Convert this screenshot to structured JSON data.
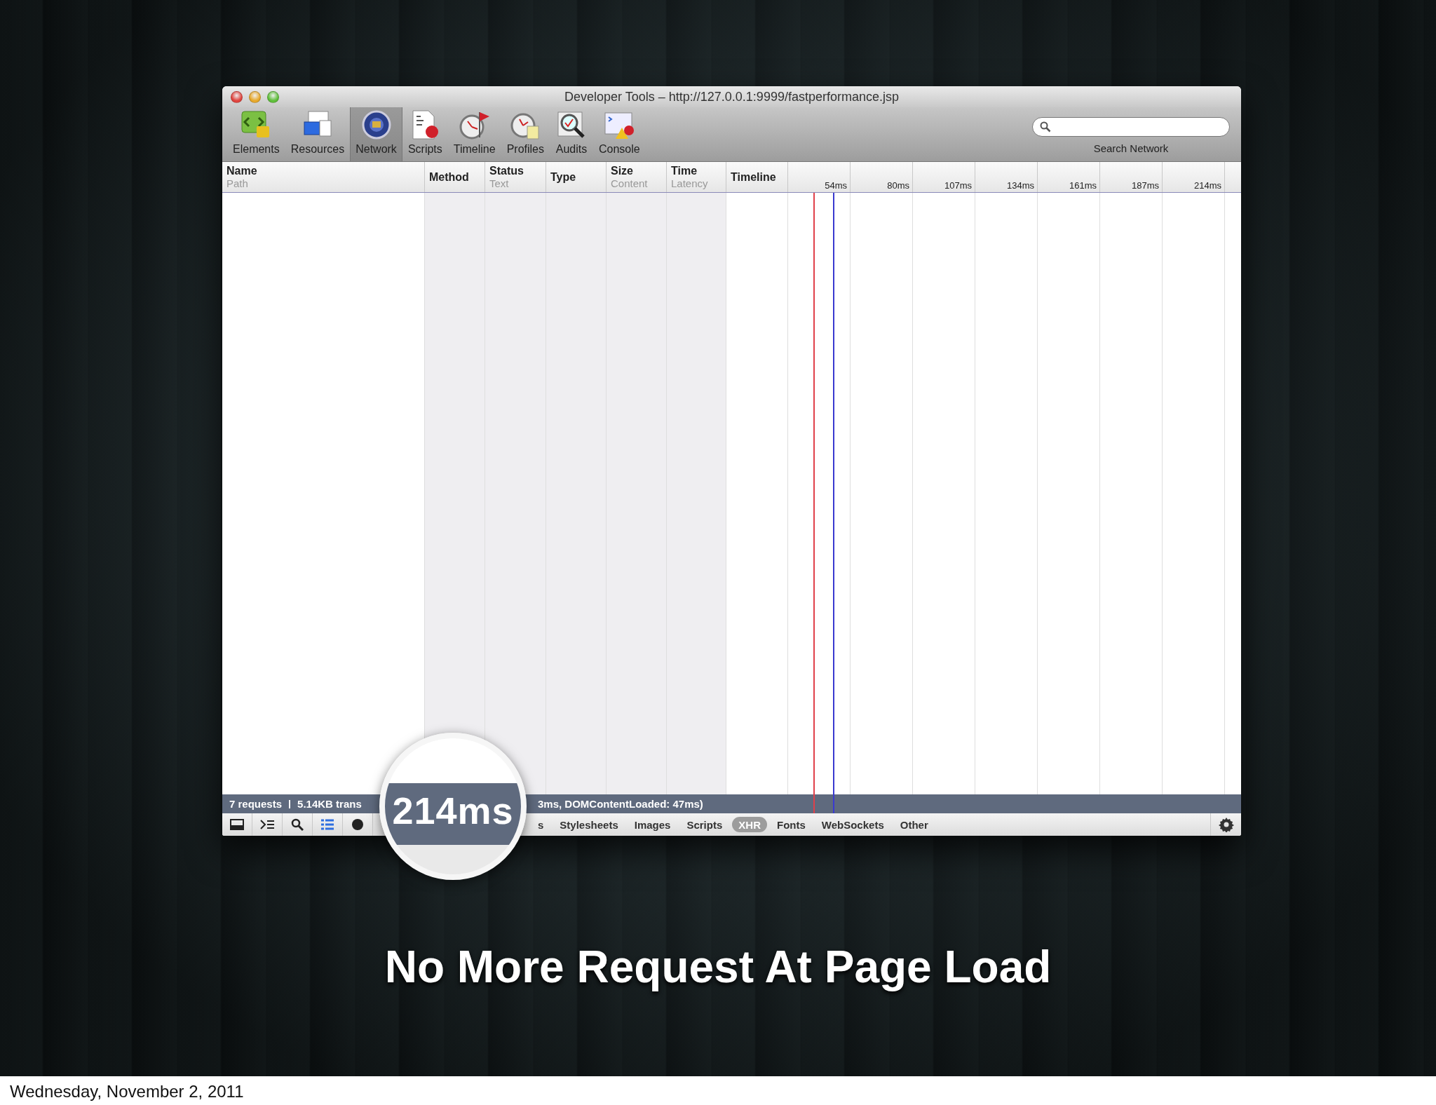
{
  "window": {
    "title": "Developer Tools – http://127.0.0.1:9999/fastperformance.jsp"
  },
  "toolbar": [
    {
      "label": "Elements",
      "kind": "elements",
      "selected": false
    },
    {
      "label": "Resources",
      "kind": "resources",
      "selected": false
    },
    {
      "label": "Network",
      "kind": "network",
      "selected": true
    },
    {
      "label": "Scripts",
      "kind": "scripts",
      "selected": false
    },
    {
      "label": "Timeline",
      "kind": "timeline",
      "selected": false
    },
    {
      "label": "Profiles",
      "kind": "profiles",
      "selected": false
    },
    {
      "label": "Audits",
      "kind": "audits",
      "selected": false
    },
    {
      "label": "Console",
      "kind": "console",
      "selected": false
    }
  ],
  "search": {
    "label": "Search Network"
  },
  "columns": [
    {
      "title": "Name",
      "subtitle": "Path"
    },
    {
      "title": "Method"
    },
    {
      "title": "Status",
      "subtitle": "Text"
    },
    {
      "title": "Type"
    },
    {
      "title": "Size",
      "subtitle": "Content"
    },
    {
      "title": "Time",
      "subtitle": "Latency"
    },
    {
      "title": "Timeline"
    }
  ],
  "timeline_ticks": [
    "54ms",
    "80ms",
    "107ms",
    "134ms",
    "161ms",
    "187ms",
    "214ms"
  ],
  "status_bar": {
    "texts": [
      "7 requests",
      "5.14KB trans",
      "3ms, DOMContentLoaded: 47ms)"
    ]
  },
  "tools": [
    {
      "kind": "dock",
      "on": false
    },
    {
      "kind": "console",
      "on": false
    },
    {
      "kind": "search",
      "on": false
    },
    {
      "kind": "list",
      "on": true
    },
    {
      "kind": "record",
      "on": false
    }
  ],
  "filters": [
    {
      "label": "s",
      "selected": false
    },
    {
      "label": "Stylesheets",
      "selected": false
    },
    {
      "label": "Images",
      "selected": false
    },
    {
      "label": "Scripts",
      "selected": false
    },
    {
      "label": "XHR",
      "selected": true
    },
    {
      "label": "Fonts",
      "selected": false
    },
    {
      "label": "WebSockets",
      "selected": false
    },
    {
      "label": "Other",
      "selected": false
    }
  ],
  "magnifier": {
    "reading": "214ms"
  },
  "slide": {
    "title": "No More Request At Page Load",
    "date": "Wednesday, November 2, 2011"
  }
}
